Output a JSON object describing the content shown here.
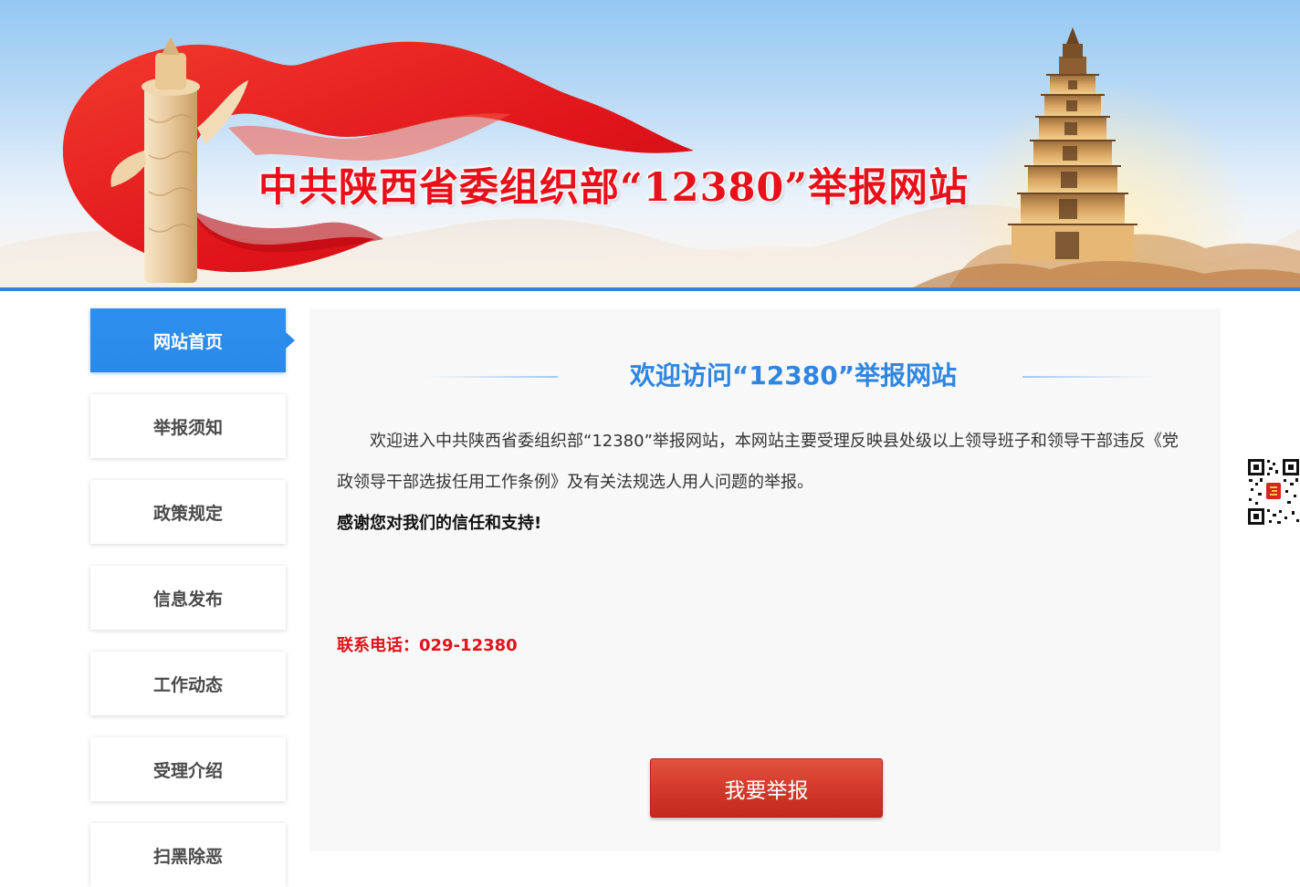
{
  "banner": {
    "title": "中共陕西省委组织部“12380”举报网站"
  },
  "sidebar": {
    "items": [
      {
        "label": "网站首页",
        "active": true
      },
      {
        "label": "举报须知",
        "active": false
      },
      {
        "label": "政策规定",
        "active": false
      },
      {
        "label": "信息发布",
        "active": false
      },
      {
        "label": "工作动态",
        "active": false
      },
      {
        "label": "受理介绍",
        "active": false
      },
      {
        "label": "扫黑除恶",
        "active": false
      }
    ]
  },
  "main": {
    "title": "欢迎访问“12380”举报网站",
    "intro": "欢迎进入中共陕西省委组织部“12380”举报网站，本网站主要受理反映县处级以上领导班子和领导干部违反《党政领导干部选拔任用工作条例》及有关法规选人用人问题的举报。",
    "thanks": "感谢您对我们的信任和支持!",
    "contact": "联系电话：029-12380",
    "report_button": "我要举报"
  },
  "colors": {
    "accent_blue": "#2e8ff0",
    "title_blue": "#2f86e0",
    "banner_red": "#e8111b",
    "contact_red": "#e0121b",
    "button_red": "#d23a2b"
  },
  "icons": {
    "qr": "qr-code-icon"
  }
}
